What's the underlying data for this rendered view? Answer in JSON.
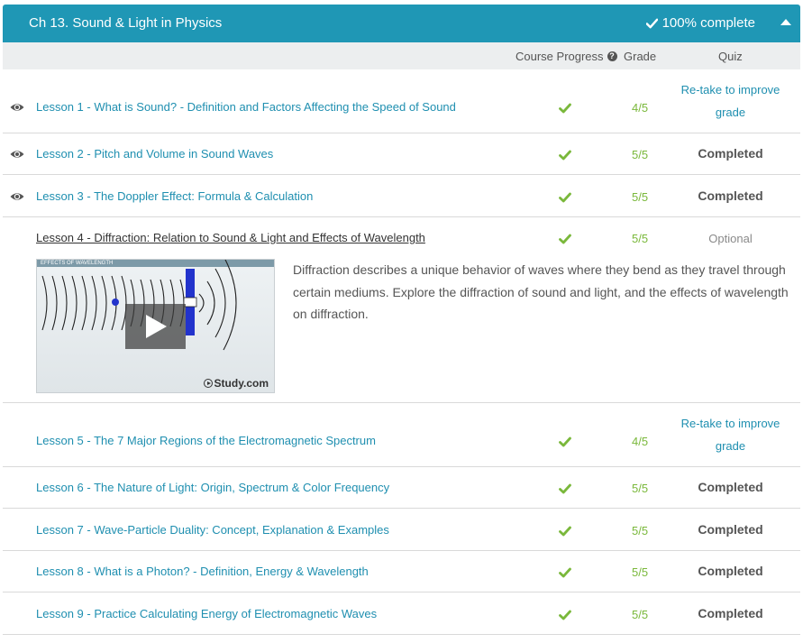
{
  "chapter": {
    "title": "Ch 13. Sound & Light in Physics",
    "completion": "100% complete"
  },
  "columns": {
    "progress": "Course Progress",
    "grade": "Grade",
    "quiz": "Quiz"
  },
  "colors": {
    "header_bg": "#1f97b5",
    "link": "#1f8fb0",
    "check_green": "#7ab83b"
  },
  "lessons": [
    {
      "label": "Lesson 1 - What is Sound? - Definition and Factors Affecting the Speed of Sound",
      "grade": "4/5",
      "quiz": "Re-take to improve grade",
      "viewed": true
    },
    {
      "label": "Lesson 2 - Pitch and Volume in Sound Waves",
      "grade": "5/5",
      "quiz": "Completed",
      "viewed": true
    },
    {
      "label": "Lesson 3 - The Doppler Effect: Formula & Calculation",
      "grade": "5/5",
      "quiz": "Completed",
      "viewed": true
    },
    {
      "label": "Lesson 4 - Diffraction: Relation to Sound & Light and Effects of Wavelength",
      "grade": "5/5",
      "quiz": "Optional",
      "viewed": false,
      "video_caption": "EFFECTS OF WAVELENGTH",
      "video_brand": "Study.com",
      "description": "Diffraction describes a unique behavior of waves where they bend as they travel through certain mediums. Explore the diffraction of sound and light, and the effects of wavelength on diffraction."
    },
    {
      "label": "Lesson 5 - The 7 Major Regions of the Electromagnetic Spectrum",
      "grade": "4/5",
      "quiz": "Re-take to improve grade",
      "viewed": false
    },
    {
      "label": "Lesson 6 - The Nature of Light: Origin, Spectrum & Color Frequency",
      "grade": "5/5",
      "quiz": "Completed",
      "viewed": false
    },
    {
      "label": "Lesson 7 - Wave-Particle Duality: Concept, Explanation & Examples",
      "grade": "5/5",
      "quiz": "Completed",
      "viewed": false
    },
    {
      "label": "Lesson 8 - What is a Photon? - Definition, Energy & Wavelength",
      "grade": "5/5",
      "quiz": "Completed",
      "viewed": false
    },
    {
      "label": "Lesson 9 - Practice Calculating Energy of Electromagnetic Waves",
      "grade": "5/5",
      "quiz": "Completed",
      "viewed": false
    }
  ]
}
